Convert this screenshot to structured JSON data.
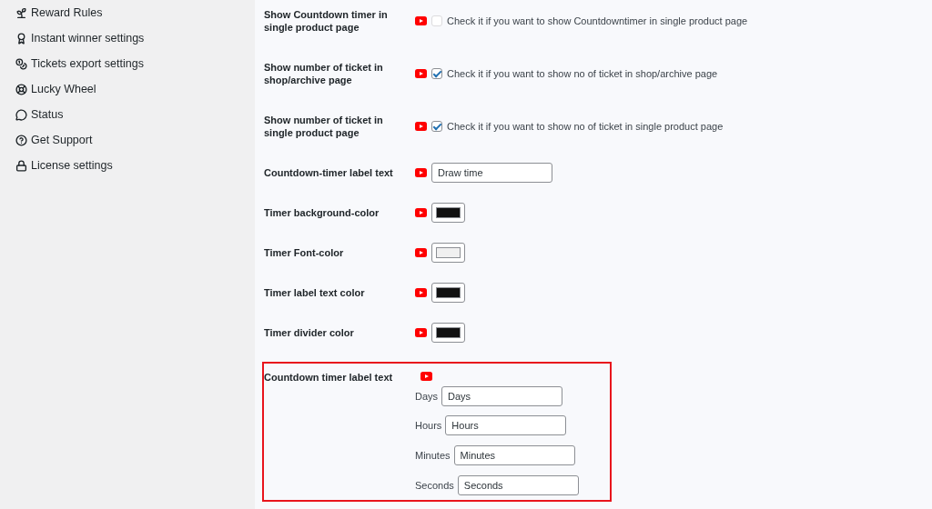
{
  "sidebar": {
    "items": [
      {
        "label": "Reward Rules"
      },
      {
        "label": "Instant winner settings"
      },
      {
        "label": "Tickets export settings"
      },
      {
        "label": "Lucky Wheel"
      },
      {
        "label": "Status"
      },
      {
        "label": "Get Support"
      },
      {
        "label": "License settings"
      }
    ]
  },
  "settings": [
    {
      "kind": "checkbox",
      "label": "Show Countdown timer in single product page",
      "checked": false,
      "description": "Check it if you want to show Countdowntimer in single product page"
    },
    {
      "kind": "checkbox",
      "label": "Show number of ticket in shop/archive page",
      "checked": true,
      "description": "Check it if you want to show no of ticket in shop/archive page"
    },
    {
      "kind": "checkbox",
      "label": "Show number of ticket in single product page",
      "checked": true,
      "description": "Check it if you want to show no of ticket in single product page"
    },
    {
      "kind": "text",
      "label": "Countdown-timer label text",
      "value": "Draw time"
    },
    {
      "kind": "color",
      "label": "Timer background-color",
      "color": "#111111"
    },
    {
      "kind": "color",
      "label": "Timer Font-color",
      "color": "#f0f0f0"
    },
    {
      "kind": "color",
      "label": "Timer label text color",
      "color": "#111111"
    },
    {
      "kind": "color",
      "label": "Timer divider color",
      "color": "#111111"
    }
  ],
  "timer_labels": {
    "label": "Countdown timer label text",
    "highlighted": true,
    "fields": [
      {
        "label": "Days",
        "value": "Days"
      },
      {
        "label": "Hours",
        "value": "Hours"
      },
      {
        "label": "Minutes",
        "value": "Minutes"
      },
      {
        "label": "Seconds",
        "value": "Seconds"
      }
    ]
  }
}
